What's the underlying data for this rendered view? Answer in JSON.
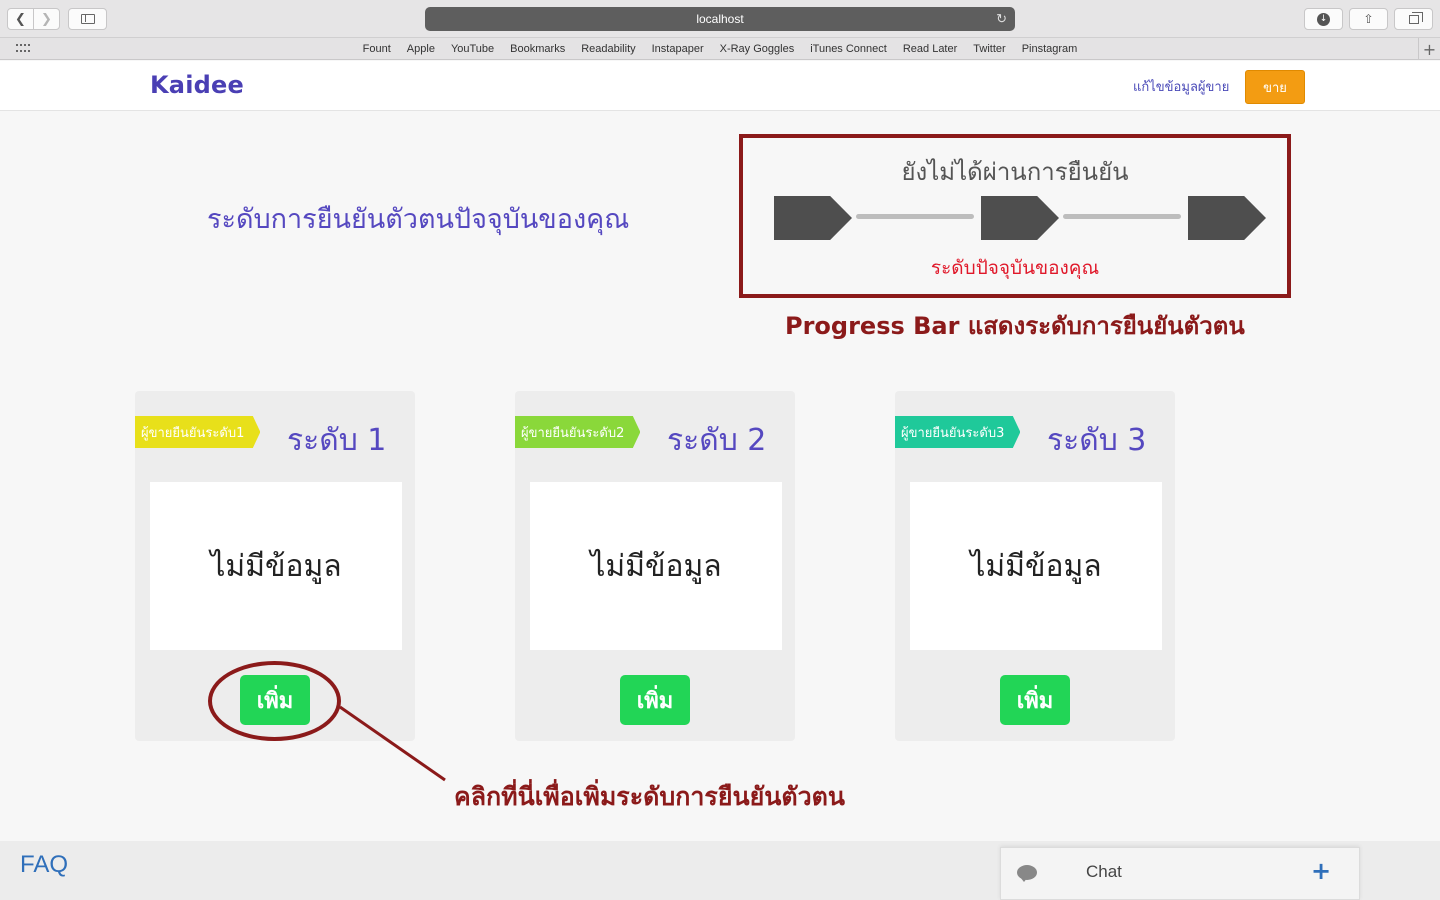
{
  "browser": {
    "url": "localhost",
    "bookmarks": [
      "Fount",
      "Apple",
      "YouTube",
      "Bookmarks",
      "Readability",
      "Instapaper",
      "X-Ray Goggles",
      "iTunes Connect",
      "Read Later",
      "Twitter",
      "Pinstagram"
    ]
  },
  "header": {
    "logo": "Kaidee",
    "edit_seller_link": "แก้ไขข้อมูลผู้ขาย",
    "sell_button": "ขาย"
  },
  "main": {
    "heading": "ระดับการยืนยันตัวตนปัจจุบันของคุณ",
    "progress": {
      "status": "ยังไม่ได้ผ่านการยืนยัน",
      "caption": "ระดับปัจจุบันของคุณ",
      "steps_completed": 0,
      "steps_total": 3,
      "annotation": "Progress Bar  แสดงระดับการยืนยันตัวตน"
    },
    "levels": [
      {
        "tag": "ผู้ขายยืนยันระดับ1",
        "tag_color": "#e8e01a",
        "title": "ระดับ 1",
        "info": "ไม่มีข้อมูล",
        "button": "เพิ่ม"
      },
      {
        "tag": "ผู้ขายยืนยันระดับ2",
        "tag_color": "#8ad83a",
        "title": "ระดับ 2",
        "info": "ไม่มีข้อมูล",
        "button": "เพิ่ม"
      },
      {
        "tag": "ผู้ขายยืนยันระดับ3",
        "tag_color": "#1fc99a",
        "title": "ระดับ 3",
        "info": "ไม่มีข้อมูล",
        "button": "เพิ่ม"
      }
    ],
    "click_annotation": "คลิกที่นี่เพื่อเพิ่มระดับการยืนยันตัวตน"
  },
  "footer": {
    "faq": "FAQ",
    "chat": {
      "label": "Chat",
      "expand": "+"
    }
  },
  "colors": {
    "accent": "#5548c0",
    "sell": "#f39c12",
    "add": "#22d556",
    "annotation": "#8b1a1a",
    "current_level": "#e0182a"
  }
}
